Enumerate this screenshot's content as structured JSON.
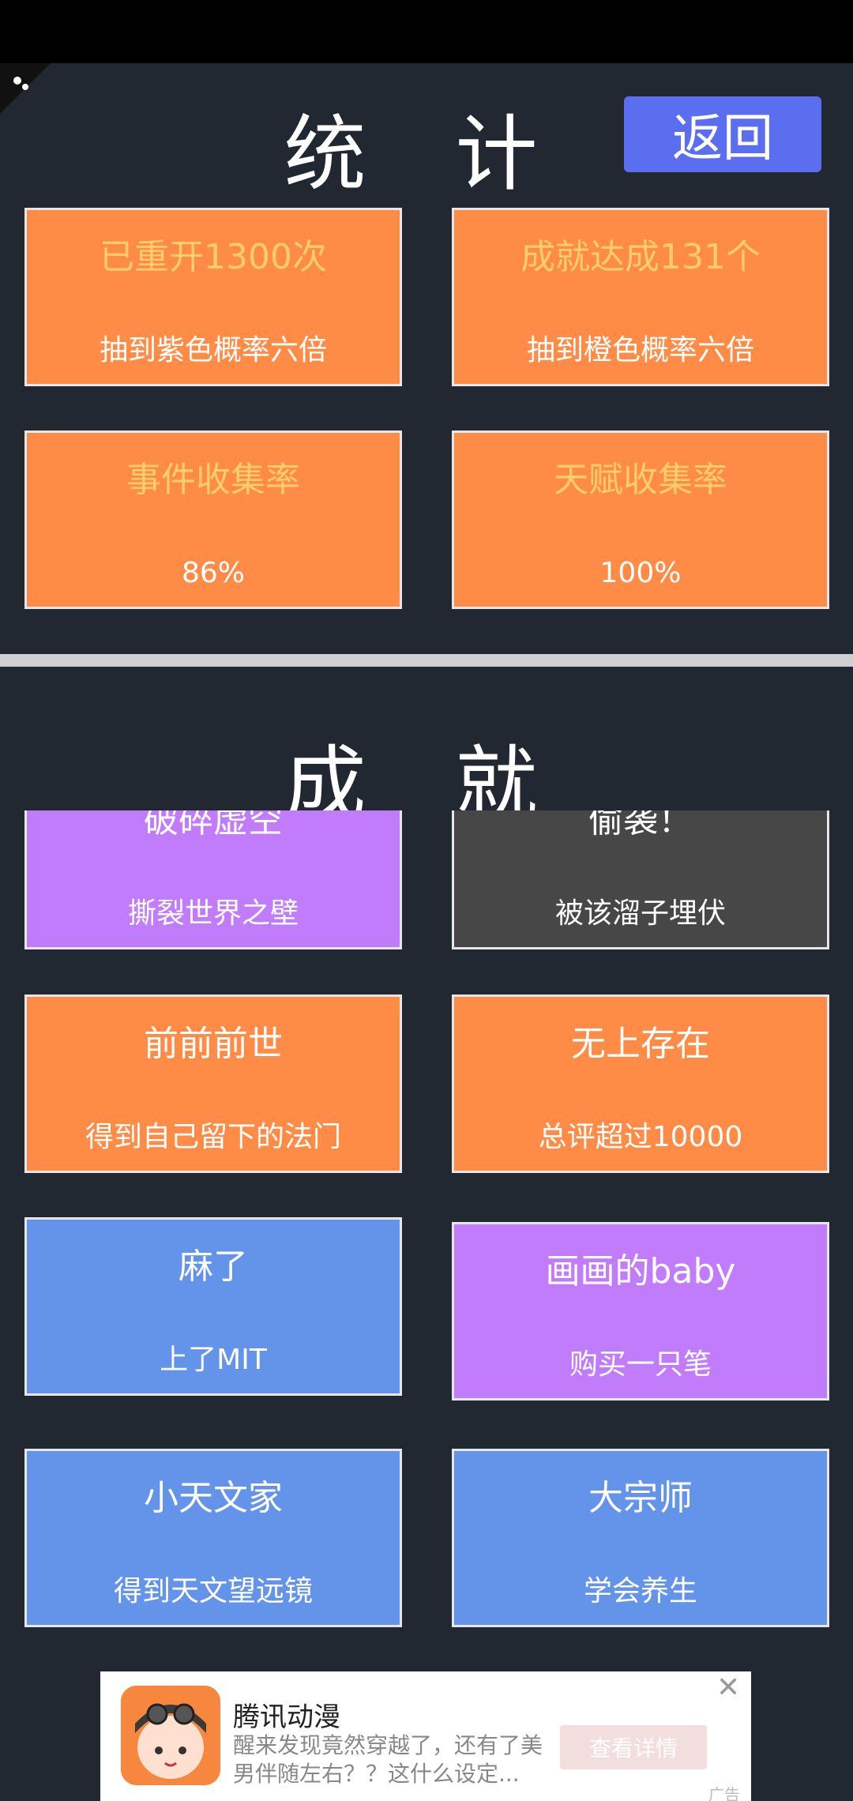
{
  "stats": {
    "title": "统 计",
    "back_label": "返回",
    "cards": [
      {
        "title": "已重开1300次",
        "subtitle": "抽到紫色概率六倍"
      },
      {
        "title": "成就达成131个",
        "subtitle": "抽到橙色概率六倍"
      },
      {
        "title": "事件收集率",
        "subtitle": "86%"
      },
      {
        "title": "天赋收集率",
        "subtitle": "100%"
      }
    ]
  },
  "achievements": {
    "title": "成 就",
    "cards": [
      {
        "title": "破碎虚空",
        "subtitle": "撕裂世界之壁",
        "color": "#c07cfb"
      },
      {
        "title": "偷袭！",
        "subtitle": "被该溜子埋伏",
        "color": "#474747"
      },
      {
        "title": "前前前世",
        "subtitle": "得到自己留下的法门",
        "color": "#ff8c46"
      },
      {
        "title": "无上存在",
        "subtitle": "总评超过10000",
        "color": "#ff8c46"
      },
      {
        "title": "麻了",
        "subtitle": "上了MIT",
        "color": "#6394ea"
      },
      {
        "title": "画画的baby",
        "subtitle": "购买一只笔",
        "color": "#c07cfb"
      },
      {
        "title": "小天文家",
        "subtitle": "得到天文望远镜",
        "color": "#6394ea"
      },
      {
        "title": "大宗师",
        "subtitle": "学会养生",
        "color": "#6394ea"
      }
    ]
  },
  "ad": {
    "app_name": "腾讯动漫",
    "description": "醒来发现竟然穿越了，还有了美男伴随左右？？这什么设定...",
    "button_label": "查看详情",
    "close": "✕",
    "tag": "广告"
  }
}
